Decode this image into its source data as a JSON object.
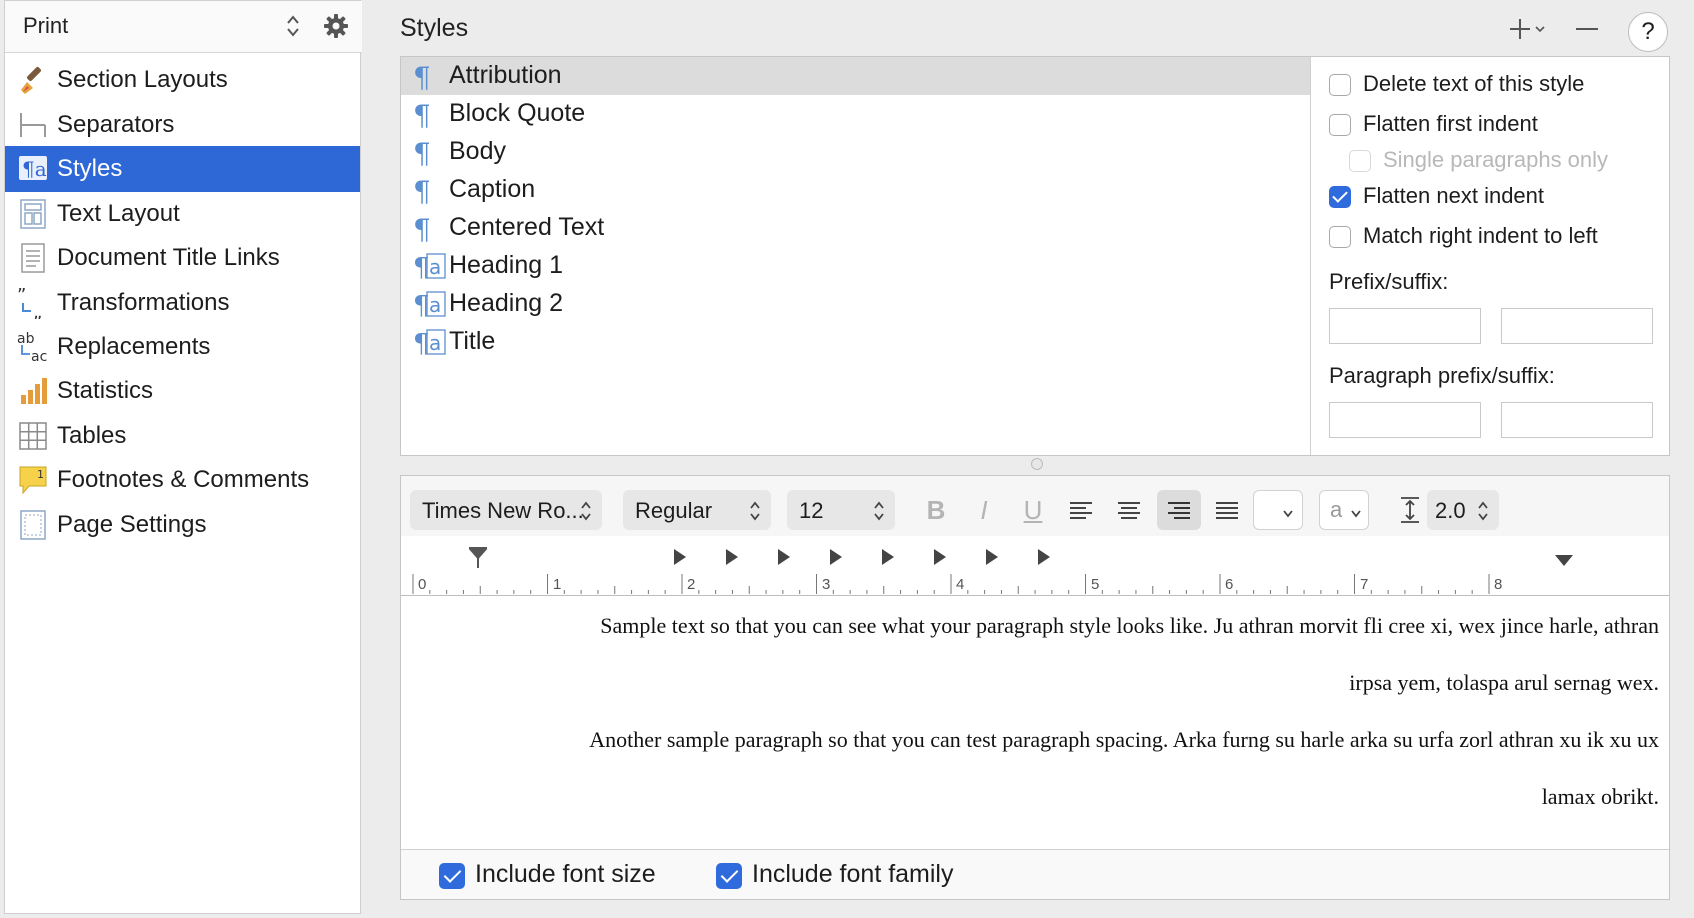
{
  "sidebar": {
    "title": "Print",
    "items": [
      {
        "label": "Section Layouts",
        "icon": "paintbrush-icon"
      },
      {
        "label": "Separators",
        "icon": "separators-icon"
      },
      {
        "label": "Styles",
        "icon": "styles-icon",
        "selected": true
      },
      {
        "label": "Text Layout",
        "icon": "text-layout-icon"
      },
      {
        "label": "Document Title Links",
        "icon": "document-icon"
      },
      {
        "label": "Transformations",
        "icon": "quotes-transform-icon"
      },
      {
        "label": "Replacements",
        "icon": "replace-ab-ac-icon"
      },
      {
        "label": "Statistics",
        "icon": "bar-chart-icon"
      },
      {
        "label": "Tables",
        "icon": "table-grid-icon"
      },
      {
        "label": "Footnotes & Comments",
        "icon": "footnote-comment-icon"
      },
      {
        "label": "Page Settings",
        "icon": "page-settings-icon"
      }
    ]
  },
  "main": {
    "title": "Styles",
    "plus_label": "+",
    "minus_label": "—",
    "help_label": "?",
    "styles": [
      {
        "name": "Attribution",
        "kind": "paragraph",
        "selected": true
      },
      {
        "name": "Block Quote",
        "kind": "paragraph"
      },
      {
        "name": "Body",
        "kind": "paragraph"
      },
      {
        "name": "Caption",
        "kind": "paragraph"
      },
      {
        "name": "Centered Text",
        "kind": "paragraph"
      },
      {
        "name": "Heading 1",
        "kind": "paragraph-character"
      },
      {
        "name": "Heading 2",
        "kind": "paragraph-character"
      },
      {
        "name": "Title",
        "kind": "paragraph-character"
      }
    ],
    "paragraph_glyph": "¶",
    "options": [
      {
        "label": "Delete text of this style",
        "checked": false
      },
      {
        "label": "Flatten first indent",
        "checked": false
      },
      {
        "label": "Single paragraphs only",
        "checked": false,
        "disabled": true
      },
      {
        "label": "Flatten next indent",
        "checked": true
      },
      {
        "label": "Match right indent to left",
        "checked": false
      }
    ],
    "prefix_suffix_label": "Prefix/suffix:",
    "paragraph_prefix_suffix_label": "Paragraph prefix/suffix:"
  },
  "editor": {
    "font_family": "Times New Ro...",
    "font_style": "Regular",
    "font_size": "12",
    "bold": "B",
    "italic": "I",
    "underline": "U",
    "case_label": "a",
    "line_spacing": "2.0",
    "ruler_numbers": [
      "0",
      "1",
      "2",
      "3",
      "4",
      "5",
      "6",
      "7",
      "8"
    ],
    "sample_paragraph_1_line_1": "Sample text so that you can see what your paragraph style looks like. Ju athran morvit fli cree xi, wex jince harle, athran",
    "sample_paragraph_1_line_2": "irpsa yem, tolaspa arul sernag wex.",
    "sample_paragraph_2_line_1": "Another sample paragraph so that you can test paragraph spacing. Arka furng su harle arka su urfa zorl athran xu ik xu ux",
    "sample_paragraph_2_line_2": "lamax obrikt.",
    "include_font_size": "Include font size",
    "include_font_family": "Include font family",
    "alignment_selected": "right"
  },
  "colors": {
    "selection_blue": "#2e67d6",
    "checkbox_blue": "#2f6bdd",
    "pilcrow_blue": "#5b8fcf"
  }
}
